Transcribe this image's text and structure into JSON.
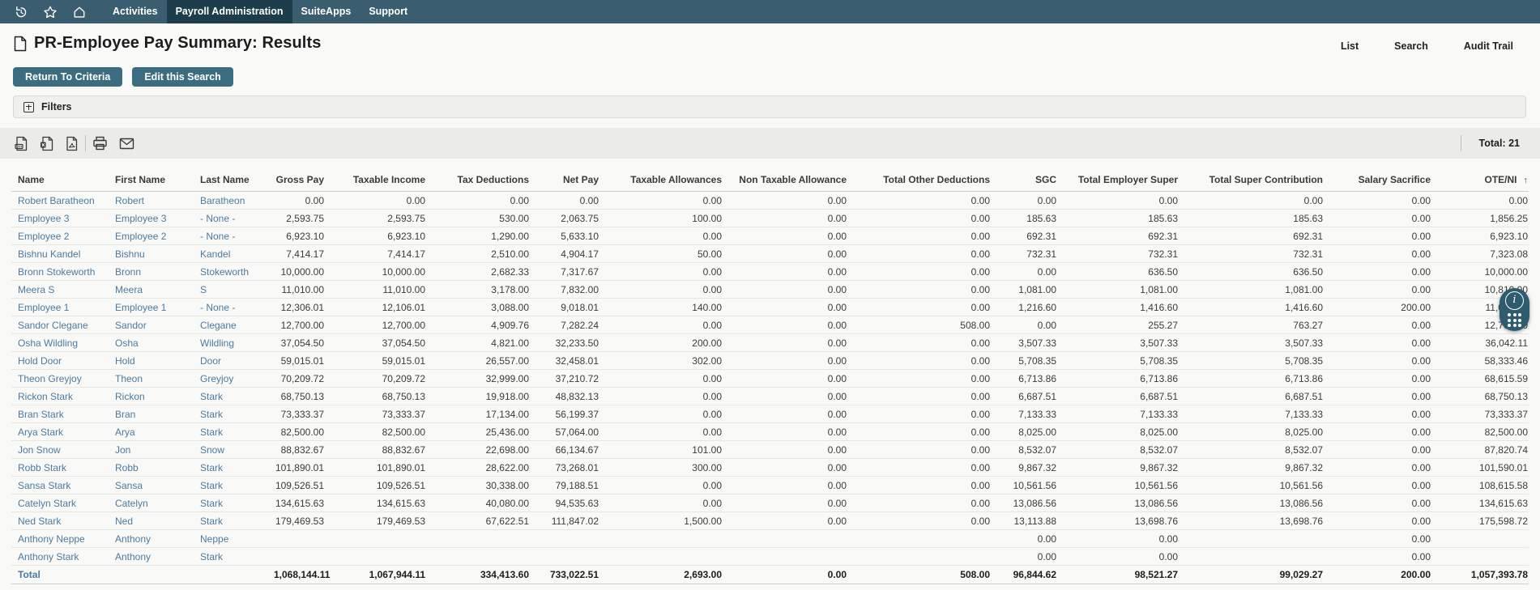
{
  "nav": {
    "icons": [
      "history-icon",
      "favorites-star-icon",
      "home-icon"
    ],
    "items": [
      {
        "label": "Activities",
        "active": false
      },
      {
        "label": "Payroll Administration",
        "active": true
      },
      {
        "label": "SuiteApps",
        "active": false
      },
      {
        "label": "Support",
        "active": false
      }
    ]
  },
  "header": {
    "title": "PR-Employee Pay Summary: Results",
    "icon": "document-icon",
    "links": [
      "List",
      "Search",
      "Audit Trail"
    ],
    "actions": [
      "Return To Criteria",
      "Edit this Search"
    ]
  },
  "filters": {
    "label": "Filters",
    "expand_icon": "plus-box-icon"
  },
  "toolbar": {
    "export_icons": [
      "csv-export-icon",
      "excel-export-icon",
      "pdf-export-icon"
    ],
    "action_icons": [
      "print-icon",
      "email-icon"
    ],
    "total_label": "Total: 21"
  },
  "table": {
    "columns": [
      {
        "label": "Name",
        "type": "text"
      },
      {
        "label": "First Name",
        "type": "text"
      },
      {
        "label": "Last Name",
        "type": "text"
      },
      {
        "label": "Gross Pay",
        "type": "number"
      },
      {
        "label": "Taxable Income",
        "type": "number"
      },
      {
        "label": "Tax Deductions",
        "type": "number"
      },
      {
        "label": "Net Pay",
        "type": "number"
      },
      {
        "label": "Taxable Allowances",
        "type": "number"
      },
      {
        "label": "Non Taxable Allowance",
        "type": "number"
      },
      {
        "label": "Total Other Deductions",
        "type": "number"
      },
      {
        "label": "SGC",
        "type": "number"
      },
      {
        "label": "Total Employer Super",
        "type": "number"
      },
      {
        "label": "Total Super Contribution",
        "type": "number"
      },
      {
        "label": "Salary Sacrifice",
        "type": "number"
      },
      {
        "label": "OTE/NI",
        "type": "number",
        "sorted": "asc"
      }
    ],
    "rows": [
      [
        "Robert Baratheon",
        "Robert",
        "Baratheon",
        "0.00",
        "0.00",
        "0.00",
        "0.00",
        "0.00",
        "0.00",
        "0.00",
        "0.00",
        "0.00",
        "0.00",
        "0.00",
        "0.00"
      ],
      [
        "Employee 3",
        "Employee 3",
        "- None -",
        "2,593.75",
        "2,593.75",
        "530.00",
        "2,063.75",
        "100.00",
        "0.00",
        "0.00",
        "185.63",
        "185.63",
        "185.63",
        "0.00",
        "1,856.25"
      ],
      [
        "Employee 2",
        "Employee 2",
        "- None -",
        "6,923.10",
        "6,923.10",
        "1,290.00",
        "5,633.10",
        "0.00",
        "0.00",
        "0.00",
        "692.31",
        "692.31",
        "692.31",
        "0.00",
        "6,923.10"
      ],
      [
        "Bishnu Kandel",
        "Bishnu",
        "Kandel",
        "7,414.17",
        "7,414.17",
        "2,510.00",
        "4,904.17",
        "50.00",
        "0.00",
        "0.00",
        "732.31",
        "732.31",
        "732.31",
        "0.00",
        "7,323.08"
      ],
      [
        "Bronn Stokeworth",
        "Bronn",
        "Stokeworth",
        "10,000.00",
        "10,000.00",
        "2,682.33",
        "7,317.67",
        "0.00",
        "0.00",
        "0.00",
        "0.00",
        "636.50",
        "636.50",
        "0.00",
        "10,000.00"
      ],
      [
        "Meera S",
        "Meera",
        "S",
        "11,010.00",
        "11,010.00",
        "3,178.00",
        "7,832.00",
        "0.00",
        "0.00",
        "0.00",
        "1,081.00",
        "1,081.00",
        "1,081.00",
        "0.00",
        "10,810.00"
      ],
      [
        "Employee 1",
        "Employee 1",
        "- None -",
        "12,306.01",
        "12,106.01",
        "3,088.00",
        "9,018.01",
        "140.00",
        "0.00",
        "0.00",
        "1,216.60",
        "1,416.60",
        "1,416.60",
        "200.00",
        "11,060.01"
      ],
      [
        "Sandor Clegane",
        "Sandor",
        "Clegane",
        "12,700.00",
        "12,700.00",
        "4,909.76",
        "7,282.24",
        "0.00",
        "0.00",
        "508.00",
        "0.00",
        "255.27",
        "763.27",
        "0.00",
        "12,700.00"
      ],
      [
        "Osha Wildling",
        "Osha",
        "Wildling",
        "37,054.50",
        "37,054.50",
        "4,821.00",
        "32,233.50",
        "200.00",
        "0.00",
        "0.00",
        "3,507.33",
        "3,507.33",
        "3,507.33",
        "0.00",
        "36,042.11"
      ],
      [
        "Hold Door",
        "Hold",
        "Door",
        "59,015.01",
        "59,015.01",
        "26,557.00",
        "32,458.01",
        "302.00",
        "0.00",
        "0.00",
        "5,708.35",
        "5,708.35",
        "5,708.35",
        "0.00",
        "58,333.46"
      ],
      [
        "Theon Greyjoy",
        "Theon",
        "Greyjoy",
        "70,209.72",
        "70,209.72",
        "32,999.00",
        "37,210.72",
        "0.00",
        "0.00",
        "0.00",
        "6,713.86",
        "6,713.86",
        "6,713.86",
        "0.00",
        "68,615.59"
      ],
      [
        "Rickon Stark",
        "Rickon",
        "Stark",
        "68,750.13",
        "68,750.13",
        "19,918.00",
        "48,832.13",
        "0.00",
        "0.00",
        "0.00",
        "6,687.51",
        "6,687.51",
        "6,687.51",
        "0.00",
        "68,750.13"
      ],
      [
        "Bran Stark",
        "Bran",
        "Stark",
        "73,333.37",
        "73,333.37",
        "17,134.00",
        "56,199.37",
        "0.00",
        "0.00",
        "0.00",
        "7,133.33",
        "7,133.33",
        "7,133.33",
        "0.00",
        "73,333.37"
      ],
      [
        "Arya Stark",
        "Arya",
        "Stark",
        "82,500.00",
        "82,500.00",
        "25,436.00",
        "57,064.00",
        "0.00",
        "0.00",
        "0.00",
        "8,025.00",
        "8,025.00",
        "8,025.00",
        "0.00",
        "82,500.00"
      ],
      [
        "Jon Snow",
        "Jon",
        "Snow",
        "88,832.67",
        "88,832.67",
        "22,698.00",
        "66,134.67",
        "101.00",
        "0.00",
        "0.00",
        "8,532.07",
        "8,532.07",
        "8,532.07",
        "0.00",
        "87,820.74"
      ],
      [
        "Robb Stark",
        "Robb",
        "Stark",
        "101,890.01",
        "101,890.01",
        "28,622.00",
        "73,268.01",
        "300.00",
        "0.00",
        "0.00",
        "9,867.32",
        "9,867.32",
        "9,867.32",
        "0.00",
        "101,590.01"
      ],
      [
        "Sansa Stark",
        "Sansa",
        "Stark",
        "109,526.51",
        "109,526.51",
        "30,338.00",
        "79,188.51",
        "0.00",
        "0.00",
        "0.00",
        "10,561.56",
        "10,561.56",
        "10,561.56",
        "0.00",
        "108,615.58"
      ],
      [
        "Catelyn Stark",
        "Catelyn",
        "Stark",
        "134,615.63",
        "134,615.63",
        "40,080.00",
        "94,535.63",
        "0.00",
        "0.00",
        "0.00",
        "13,086.56",
        "13,086.56",
        "13,086.56",
        "0.00",
        "134,615.63"
      ],
      [
        "Ned Stark",
        "Ned",
        "Stark",
        "179,469.53",
        "179,469.53",
        "67,622.51",
        "111,847.02",
        "1,500.00",
        "0.00",
        "0.00",
        "13,113.88",
        "13,698.76",
        "13,698.76",
        "0.00",
        "175,598.72"
      ],
      [
        "Anthony Neppe",
        "Anthony",
        "Neppe",
        "",
        "",
        "",
        "",
        "",
        "",
        "",
        "0.00",
        "0.00",
        "",
        "0.00",
        ""
      ],
      [
        "Anthony Stark",
        "Anthony",
        "Stark",
        "",
        "",
        "",
        "",
        "",
        "",
        "",
        "0.00",
        "0.00",
        "",
        "0.00",
        ""
      ]
    ],
    "total_row": [
      "Total",
      "",
      "",
      "1,068,144.11",
      "1,067,944.11",
      "334,413.60",
      "733,022.51",
      "2,693.00",
      "0.00",
      "508.00",
      "96,844.62",
      "98,521.27",
      "99,029.27",
      "200.00",
      "1,057,393.78"
    ]
  },
  "floating_widget": {
    "icons": [
      "info-icon",
      "dialpad-icon"
    ]
  },
  "colors": {
    "nav_background": "#3a5d70",
    "nav_active_background": "#1d3d4c",
    "button_background": "#3c6c80",
    "link_color": "#4d7a9e",
    "toolbar_background": "#ebebe9",
    "filters_background": "#f0f0ee",
    "page_background": "#f9f9f7",
    "widget_background": "#2e5b6e"
  }
}
